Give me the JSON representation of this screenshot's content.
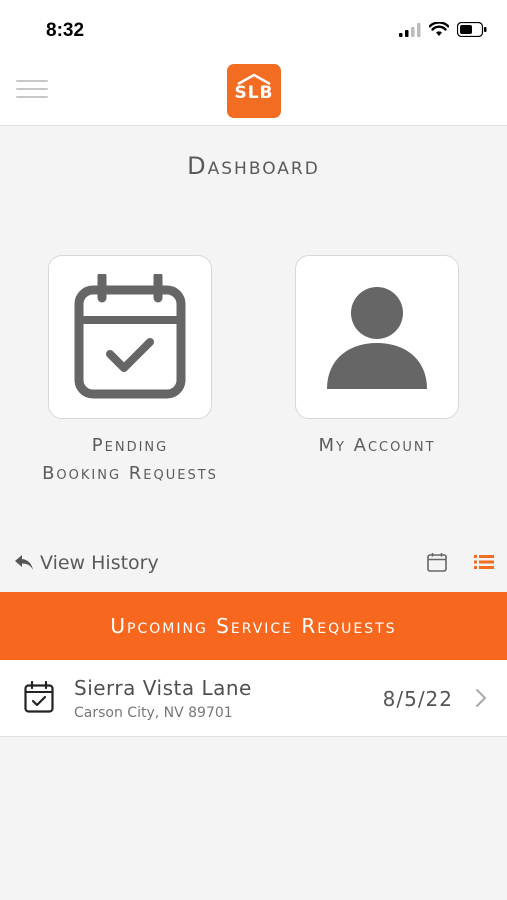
{
  "status_bar": {
    "time": "8:32"
  },
  "brand": {
    "logo_text": "SLB",
    "accent_color": "#f26c22"
  },
  "page": {
    "title": "Dashboard"
  },
  "tiles": [
    {
      "id": "pending",
      "line1": "Pending",
      "line2": "Booking Requests",
      "icon": "calendar-check-icon"
    },
    {
      "id": "account",
      "line1": "My Account",
      "icon": "user-icon"
    }
  ],
  "history": {
    "label": "View History"
  },
  "section": {
    "title": "Upcoming Service Requests"
  },
  "requests": [
    {
      "title": "Sierra Vista Lane",
      "address": "Carson City, NV 89701",
      "date": "8/5/22"
    }
  ]
}
